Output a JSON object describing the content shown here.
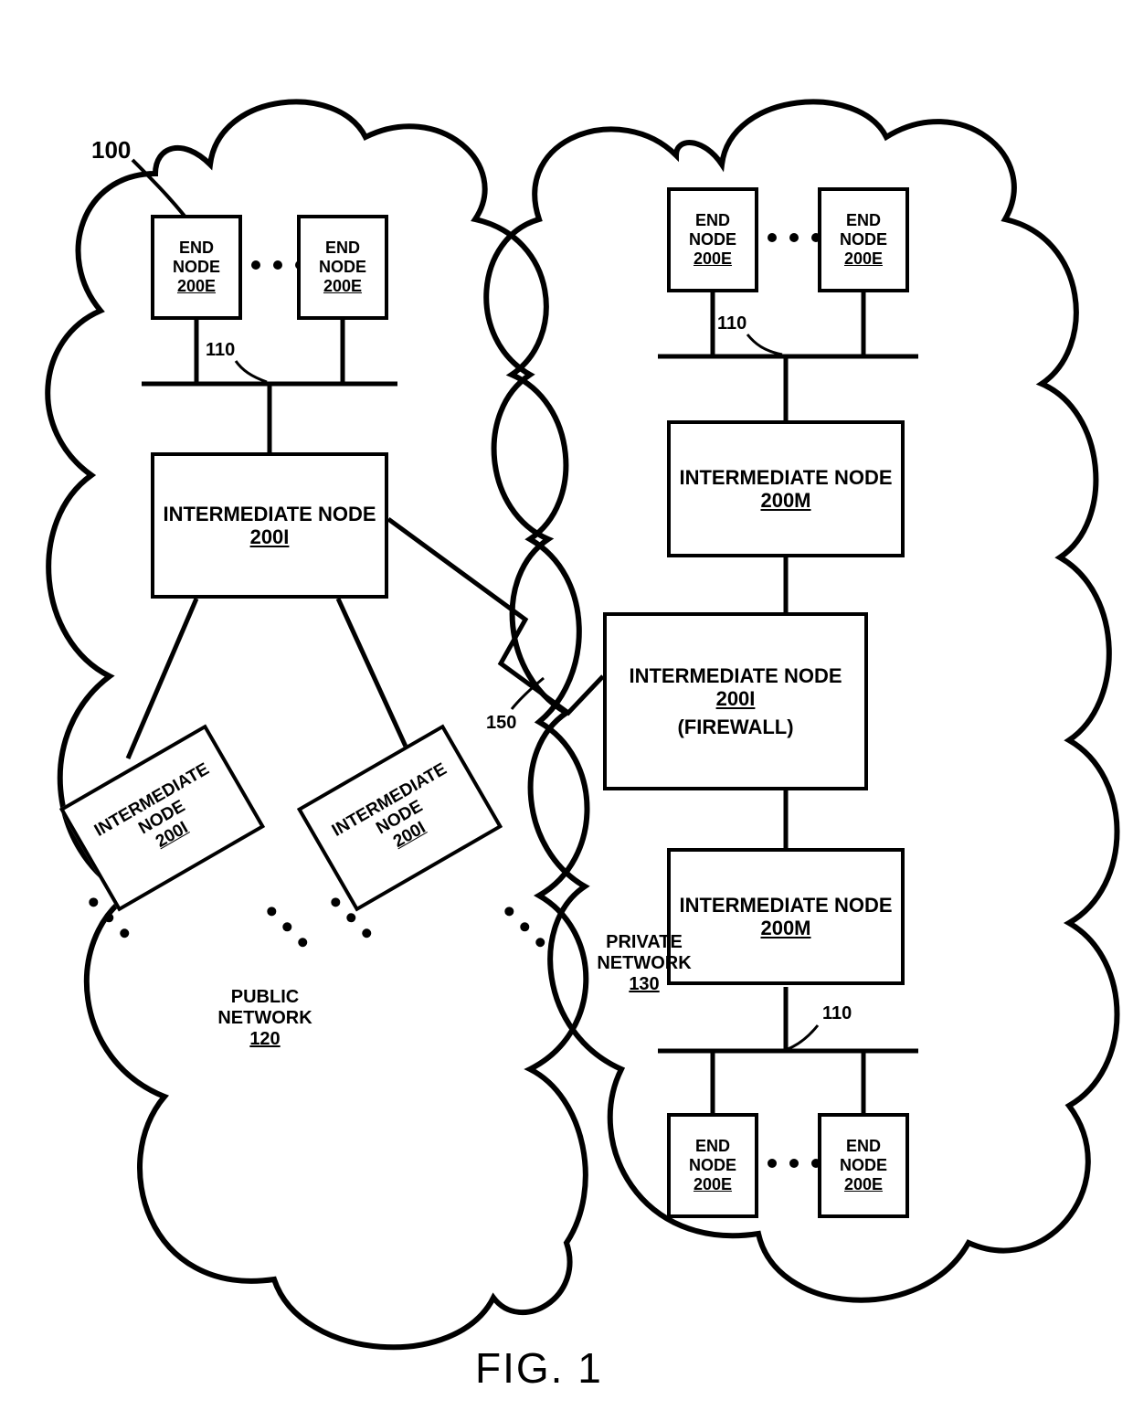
{
  "figure": {
    "number_label": "100",
    "caption": "FIG. 1"
  },
  "public_network": {
    "label": "PUBLIC NETWORK",
    "ref": "120",
    "end_nodes": [
      {
        "title": "END NODE",
        "ref": "200E"
      },
      {
        "title": "END NODE",
        "ref": "200E"
      }
    ],
    "intermediate_main": {
      "title": "INTERMEDIATE NODE",
      "ref": "200I"
    },
    "intermediate_lower": [
      {
        "title": "INTERMEDIATE NODE",
        "ref": "200I"
      },
      {
        "title": "INTERMEDIATE NODE",
        "ref": "200I"
      }
    ],
    "bus_ref": "110"
  },
  "private_network": {
    "label": "PRIVATE NETWORK",
    "ref": "130",
    "end_nodes_top": [
      {
        "title": "END NODE",
        "ref": "200E"
      },
      {
        "title": "END NODE",
        "ref": "200E"
      }
    ],
    "end_nodes_bottom": [
      {
        "title": "END NODE",
        "ref": "200E"
      },
      {
        "title": "END NODE",
        "ref": "200E"
      }
    ],
    "intermediate_top": {
      "title": "INTERMEDIATE NODE",
      "ref": "200M"
    },
    "intermediate_bottom": {
      "title": "INTERMEDIATE NODE",
      "ref": "200M"
    },
    "firewall": {
      "title": "INTERMEDIATE NODE",
      "ref": "200I",
      "subtitle": "(FIREWALL)"
    },
    "bus_ref_top": "110",
    "bus_ref_bottom": "110"
  },
  "wan_link_ref": "150"
}
